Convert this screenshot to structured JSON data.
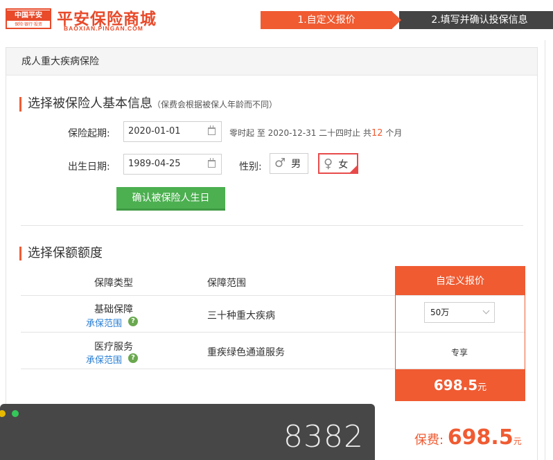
{
  "header": {
    "logo_badge": "中国平安",
    "logo_tagline": "保险·银行·投资",
    "brand_title": "平安保险商城",
    "brand_url": "BAOXIAN.PINGAN.COM",
    "steps": [
      "1.自定义报价",
      "2.填写并确认投保信息"
    ],
    "active_step_color": "#f05b32"
  },
  "card": {
    "title": "成人重大疾病保险"
  },
  "basic_info": {
    "section_title": "选择被保险人基本信息",
    "section_note": "（保费会根据被保人年龄而不同）",
    "start_label": "保险起期:",
    "start_value": "2020-01-01",
    "period_text_pre": "零时起 至 2020-12-31 二十四时止 共",
    "period_months": "12",
    "period_text_post": " 个月",
    "birth_label": "出生日期:",
    "birth_value": "1989-04-25",
    "gender_label": "性别:",
    "gender_male": "男",
    "gender_female": "女",
    "gender_selected": "female",
    "confirm_button": "确认被保险人生日"
  },
  "coverage": {
    "section_title": "选择保额额度",
    "col_type": "保障类型",
    "col_scope": "保障范围",
    "col_custom": "自定义报价",
    "rows": [
      {
        "type": "基础保障",
        "link": "承保范围",
        "scope": "三十种重大疾病",
        "value": "50万"
      },
      {
        "type": "医疗服务",
        "link": "承保范围",
        "scope": "重疾绿色通道服务",
        "value": "专享"
      }
    ],
    "price": "698.5",
    "price_unit": "元"
  },
  "total": {
    "label": "保费:",
    "amount": "698.5",
    "unit": "元"
  },
  "widget": {
    "counter": "8382",
    "dot_colors": [
      "#e6b800",
      "#34c759"
    ]
  }
}
